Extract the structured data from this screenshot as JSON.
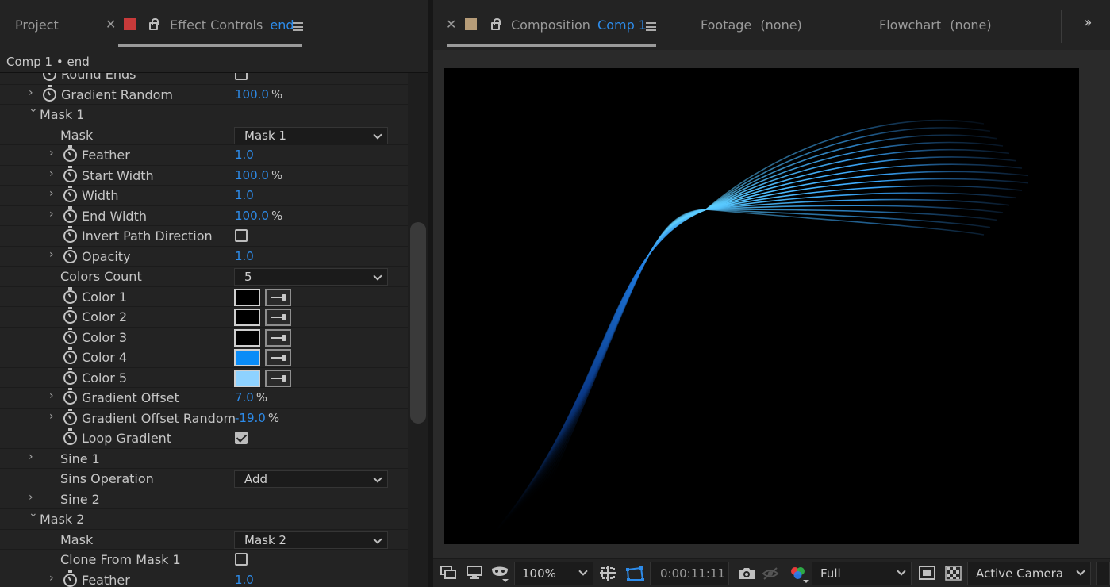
{
  "left_panel": {
    "tabs": {
      "project": "Project",
      "effect_controls": "Effect Controls",
      "effect_controls_layer": "end"
    },
    "comp_header": "Comp 1 • end",
    "rows": [
      {
        "label": "Round Ends",
        "indent": 1,
        "stopwatch": true,
        "twirl": "",
        "kind": "checkbox",
        "checked": false
      },
      {
        "label": "Gradient Random",
        "indent": 1,
        "stopwatch": true,
        "twirl": "right",
        "kind": "value",
        "value": "100.0",
        "unit": "%"
      },
      {
        "label": "Mask 1",
        "indent": 0,
        "stopwatch": false,
        "twirl": "down",
        "kind": "group"
      },
      {
        "label": "Mask",
        "indent": 2,
        "stopwatch": false,
        "twirl": "",
        "kind": "dropdown",
        "value": "Mask 1"
      },
      {
        "label": "Feather",
        "indent": 2,
        "stopwatch": true,
        "twirl": "right",
        "kind": "value",
        "value": "1.0",
        "unit": ""
      },
      {
        "label": "Start Width",
        "indent": 2,
        "stopwatch": true,
        "twirl": "right",
        "kind": "value",
        "value": "100.0",
        "unit": "%"
      },
      {
        "label": "Width",
        "indent": 2,
        "stopwatch": true,
        "twirl": "right",
        "kind": "value",
        "value": "1.0",
        "unit": ""
      },
      {
        "label": "End Width",
        "indent": 2,
        "stopwatch": true,
        "twirl": "right",
        "kind": "value",
        "value": "100.0",
        "unit": "%"
      },
      {
        "label": "Invert Path Direction",
        "indent": 2,
        "stopwatch": true,
        "twirl": "",
        "kind": "checkbox",
        "checked": false
      },
      {
        "label": "Opacity",
        "indent": 2,
        "stopwatch": true,
        "twirl": "right",
        "kind": "value",
        "value": "1.0",
        "unit": ""
      },
      {
        "label": "Colors Count",
        "indent": 2,
        "stopwatch": false,
        "twirl": "",
        "kind": "dropdown",
        "value": "5"
      },
      {
        "label": "Color 1",
        "indent": 2,
        "stopwatch": true,
        "twirl": "",
        "kind": "color",
        "color": "#000000"
      },
      {
        "label": "Color 2",
        "indent": 2,
        "stopwatch": true,
        "twirl": "",
        "kind": "color",
        "color": "#000000"
      },
      {
        "label": "Color 3",
        "indent": 2,
        "stopwatch": true,
        "twirl": "",
        "kind": "color",
        "color": "#000000"
      },
      {
        "label": "Color 4",
        "indent": 2,
        "stopwatch": true,
        "twirl": "",
        "kind": "color",
        "color": "#0a8cf7"
      },
      {
        "label": "Color 5",
        "indent": 2,
        "stopwatch": true,
        "twirl": "",
        "kind": "color",
        "color": "#8ed2ff"
      },
      {
        "label": "Gradient Offset",
        "indent": 2,
        "stopwatch": true,
        "twirl": "right",
        "kind": "value",
        "value": "7.0",
        "unit": "%"
      },
      {
        "label": "Gradient Offset Random",
        "indent": 2,
        "stopwatch": true,
        "twirl": "right",
        "kind": "value",
        "value": "-19.0",
        "unit": "%"
      },
      {
        "label": "Loop Gradient",
        "indent": 2,
        "stopwatch": true,
        "twirl": "",
        "kind": "checkbox",
        "checked": true
      },
      {
        "label": "Sine 1",
        "indent": 1,
        "stopwatch": false,
        "twirl": "right",
        "kind": "group"
      },
      {
        "label": "Sins Operation",
        "indent": 2,
        "stopwatch": false,
        "twirl": "",
        "kind": "dropdown",
        "value": "Add"
      },
      {
        "label": "Sine 2",
        "indent": 1,
        "stopwatch": false,
        "twirl": "right",
        "kind": "group"
      },
      {
        "label": "Mask 2",
        "indent": 0,
        "stopwatch": false,
        "twirl": "down",
        "kind": "group"
      },
      {
        "label": "Mask",
        "indent": 2,
        "stopwatch": false,
        "twirl": "",
        "kind": "dropdown",
        "value": "Mask 2"
      },
      {
        "label": "Clone From Mask 1",
        "indent": 2,
        "stopwatch": false,
        "twirl": "",
        "kind": "checkbox",
        "checked": false
      },
      {
        "label": "Feather",
        "indent": 2,
        "stopwatch": true,
        "twirl": "right",
        "kind": "value",
        "value": "1.0",
        "unit": ""
      }
    ]
  },
  "right_panel": {
    "tabs": {
      "composition": "Composition",
      "composition_name": "Comp 1",
      "footage": "Footage",
      "footage_value": "(none)",
      "flowchart": "Flowchart",
      "flowchart_value": "(none)"
    },
    "viewer": {
      "canvas_color": "#000000",
      "line_colors": [
        "#0a3a8a",
        "#1e7ae0",
        "#5fd0ff",
        "#3aa8ff"
      ]
    },
    "bottom_bar": {
      "zoom": "100%",
      "timecode": "0:00:11:11",
      "resolution": "Full",
      "camera": "Active Camera",
      "icons": [
        "always-preview-icon",
        "monitor-icon",
        "mask-visibility-icon",
        "region-of-interest-icon",
        "transparency-grid-icon",
        "snapshot-icon",
        "show-snapshot-icon",
        "color-channels-icon",
        "fast-preview-icon",
        "checkerboard-icon"
      ]
    }
  },
  "colors": {
    "accent_blue": "#2d8ceb",
    "panel_bg": "#232323",
    "close_red": "#c83a3a",
    "comp_tan": "#b69c78"
  }
}
